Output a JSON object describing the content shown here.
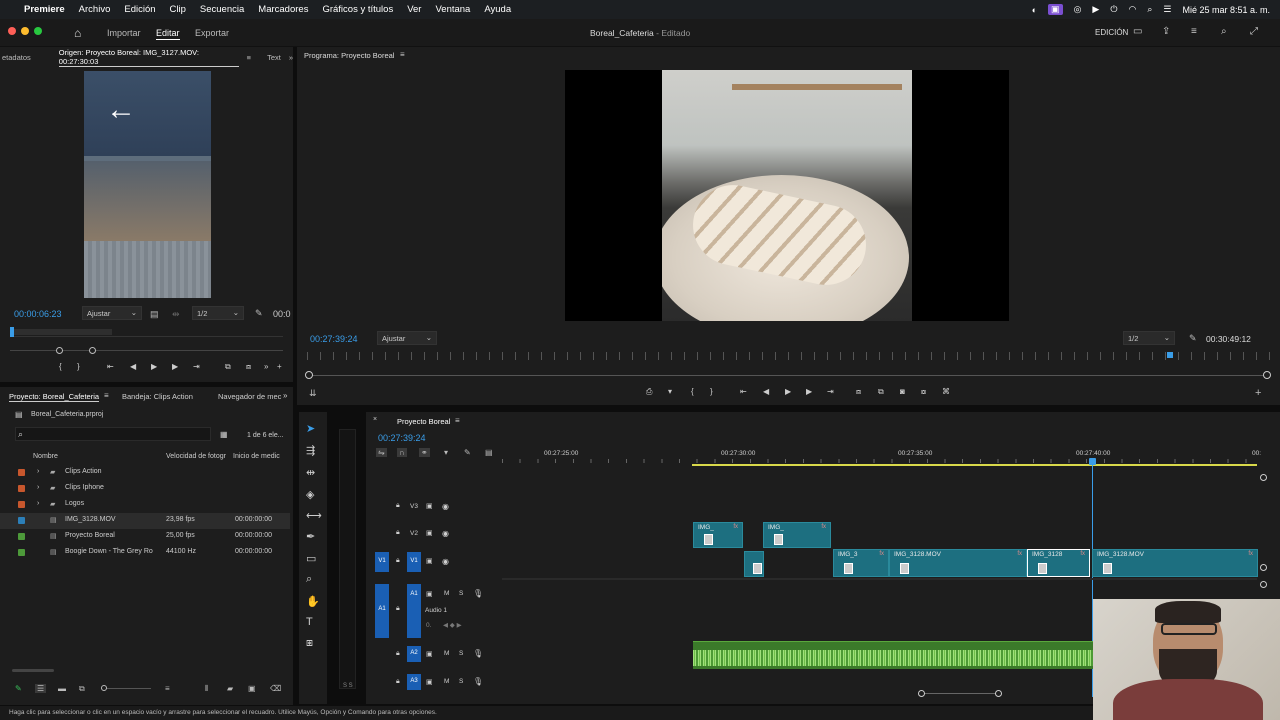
{
  "menubar": {
    "app": "Premiere",
    "items": [
      "Archivo",
      "Edición",
      "Clip",
      "Secuencia",
      "Marcadores",
      "Gráficos y títulos",
      "Ver",
      "Ventana",
      "Ayuda"
    ],
    "datetime": "Mié 25 mar 8:51 a. m."
  },
  "header": {
    "tabs": [
      "Importar",
      "Editar",
      "Exportar"
    ],
    "title": "Boreal_Cafeteria",
    "status": "- Editado",
    "workspace": "EDICIÓN"
  },
  "source": {
    "tab_meta": "etadatos",
    "title": "Origen: Proyecto Boreal: IMG_3127.MOV: 00:27:30:03",
    "tab_text": "Text",
    "timecode": "00:00:06:23",
    "fit": "Ajustar",
    "res": "1/2",
    "end_tc": "00:0"
  },
  "program": {
    "title": "Programa: Proyecto Boreal",
    "timecode": "00:27:39:24",
    "fit": "Ajustar",
    "res": "1/2",
    "end_tc": "00:30:49:12"
  },
  "project": {
    "tabs": [
      "Proyecto: Boreal_Cafeteria",
      "Bandeja: Clips Action",
      "Navegador de mec"
    ],
    "file": "Boreal_Cafeteria.prproj",
    "count": "1 de 6 ele...",
    "columns": [
      "Nombre",
      "Velocidad de fotogr",
      "Inicio de medic"
    ],
    "items": [
      {
        "name": "Clips Action",
        "fps": "",
        "start": "",
        "color": "#c8572d",
        "folder": true
      },
      {
        "name": "Clips Iphone",
        "fps": "",
        "start": "",
        "color": "#c8572d",
        "folder": true
      },
      {
        "name": "Logos",
        "fps": "",
        "start": "",
        "color": "#c8572d",
        "folder": true
      },
      {
        "name": "IMG_3128.MOV",
        "fps": "23,98 fps",
        "start": "00:00:00:00",
        "color": "#2c7fb8",
        "folder": false
      },
      {
        "name": "Proyecto Boreal",
        "fps": "25,00 fps",
        "start": "00:00:00:00",
        "color": "#4d9a3a",
        "folder": false
      },
      {
        "name": "Boogie Down - The Grey Ro",
        "fps": "44100 Hz",
        "start": "00:00:00:00",
        "color": "#4d9a3a",
        "folder": false
      }
    ]
  },
  "timeline": {
    "title": "Proyecto Boreal",
    "timecode": "00:27:39:24",
    "ruler": [
      "00:27:25:00",
      "00:27:30:00",
      "00:27:35:00",
      "00:27:40:00",
      "00:"
    ],
    "tracks": [
      "V3",
      "V2",
      "V1",
      "A1",
      "A2",
      "A3"
    ],
    "audio1_label": "Audio 1",
    "audio1_vol": "0.",
    "clips": [
      {
        "label": "IMG_",
        "fx": "fx"
      },
      {
        "label": "IMG_",
        "fx": "fx"
      },
      {
        "label": "IMG_3",
        "fx": "fx"
      },
      {
        "label": "IMG_3128.MOV",
        "fx": "fx"
      },
      {
        "label": "IMG_3128",
        "fx": "fx"
      },
      {
        "label": "IMG_3128.MOV",
        "fx": "fx"
      }
    ]
  },
  "statusbar": "Haga clic para seleccionar o clic en un espacio vacío y arrastre para seleccionar el recuadro. Utilice Mayús, Opción y Comando para otras opciones.",
  "colors": {
    "accent": "#3a9de8",
    "clip": "#1d6f80",
    "audio": "#6fbf4a",
    "track_blue": "#1a5fb4"
  }
}
